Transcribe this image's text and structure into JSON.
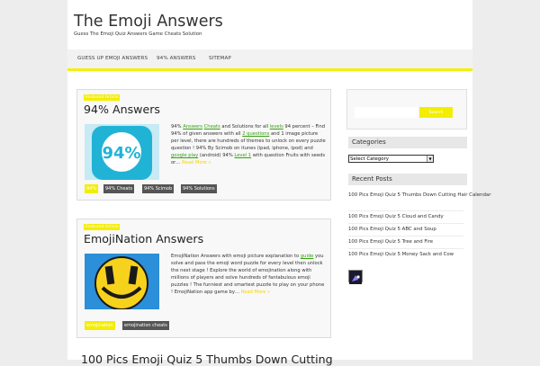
{
  "site": {
    "title": "The Emoji Answers",
    "description": "Guess The Emoji Quiz Answers Game Cheats Solution"
  },
  "nav": {
    "items": [
      "GUESS UP EMOJI ANSWERS",
      "94% ANSWERS",
      "SITEMAP"
    ]
  },
  "posts": [
    {
      "category": "Featured Article",
      "title": "94% Answers",
      "excerpt_parts": [
        {
          "t": "94% "
        },
        {
          "t": "Answers",
          "link": true
        },
        {
          "t": " "
        },
        {
          "t": "Cheats",
          "link": true
        },
        {
          "t": " and Solutions for all "
        },
        {
          "t": "levels",
          "link": true
        },
        {
          "t": " 94 percent – Find 94% of given answers with all "
        },
        {
          "t": "2 questions",
          "link": true
        },
        {
          "t": " and 1 image picture per level, there are hundreds of themes to unlock on every puzzle question ! 94% By Scimob on itunes (ipad, iphone, ipod) and "
        },
        {
          "t": "google play",
          "link": true
        },
        {
          "t": " (android) 94% "
        },
        {
          "t": "Level 1",
          "link": true
        },
        {
          "t": " with question Fruits with seeds or… "
        },
        {
          "t": "Read More »",
          "more": true
        }
      ],
      "tags": [
        {
          "label": "94%",
          "style": "y"
        },
        {
          "label": "94% Cheats",
          "style": "g"
        },
        {
          "label": "94% Scimob",
          "style": "g"
        },
        {
          "label": "94% Solutions",
          "style": "g"
        }
      ],
      "thumb_text": "94%"
    },
    {
      "category": "Featured Article",
      "title": "EmojiNation Answers",
      "excerpt_parts": [
        {
          "t": "EmojiNation Answers with emoji picture explanation to "
        },
        {
          "t": "guide",
          "link": true
        },
        {
          "t": " you solve and pass the emoji word puzzle for every level then unlock the next stage ! Explore the world of emojination along with millions of players and solve hundreds of fantabulous emoji puzzles ! The funniest and smartest puzzle to play on your phone ! EmojiNation app game by… "
        },
        {
          "t": "Read More »",
          "more": true
        }
      ],
      "tags": [
        {
          "label": "emojination",
          "style": "y"
        },
        {
          "label": "emojination cheats",
          "style": "g"
        }
      ]
    }
  ],
  "next_post_title": "100 Pics Emoji Quiz 5 Thumbs Down Cutting",
  "sidebar": {
    "search_placeholder": "",
    "search_button": "Search",
    "categories_title": "Categories",
    "category_select": "Select Category",
    "recent_title": "Recent Posts",
    "recent_posts": [
      "100 Pics Emoji Quiz 5 Thumbs Down Cutting Hair Calendar",
      "100 Pics Emoji Quiz 5 Cloud and Candy",
      "100 Pics Emoji Quiz 5 ABC and Soup",
      "100 Pics Emoji Quiz 5 Tree and Fire",
      "100 Pics Emoji Quiz 5 Money Sack and Cow"
    ]
  },
  "colors": {
    "accent": "#f3ee00",
    "link": "#35a010",
    "tag_dark": "#555555",
    "thumb_94": "#21b3d6",
    "emoji_face": "#f7d21c",
    "emoji_bg": "#2b8fd9"
  }
}
